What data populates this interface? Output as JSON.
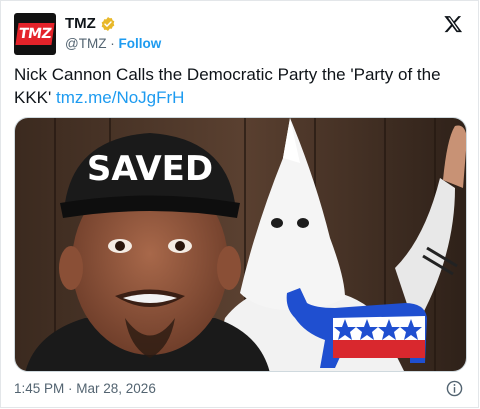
{
  "author": {
    "name": "TMZ",
    "handle": "@TMZ",
    "separator": "·",
    "follow_label": "Follow",
    "avatar_text": "TMZ"
  },
  "tweet": {
    "text": "Nick Cannon Calls the Democratic Party the 'Party of the KKK'",
    "link": "tmz.me/NoJgFrH"
  },
  "media": {
    "hat_text": "SAVED",
    "description_icon": "photo-composite"
  },
  "footer": {
    "timestamp": "1:45 PM · Mar 28, 2026"
  },
  "colors": {
    "link": "#1d9bf0",
    "verified": "#e8b829",
    "brand": "#e4232a"
  },
  "icons": [
    "x-logo-icon",
    "verified-badge-icon",
    "info-icon"
  ]
}
